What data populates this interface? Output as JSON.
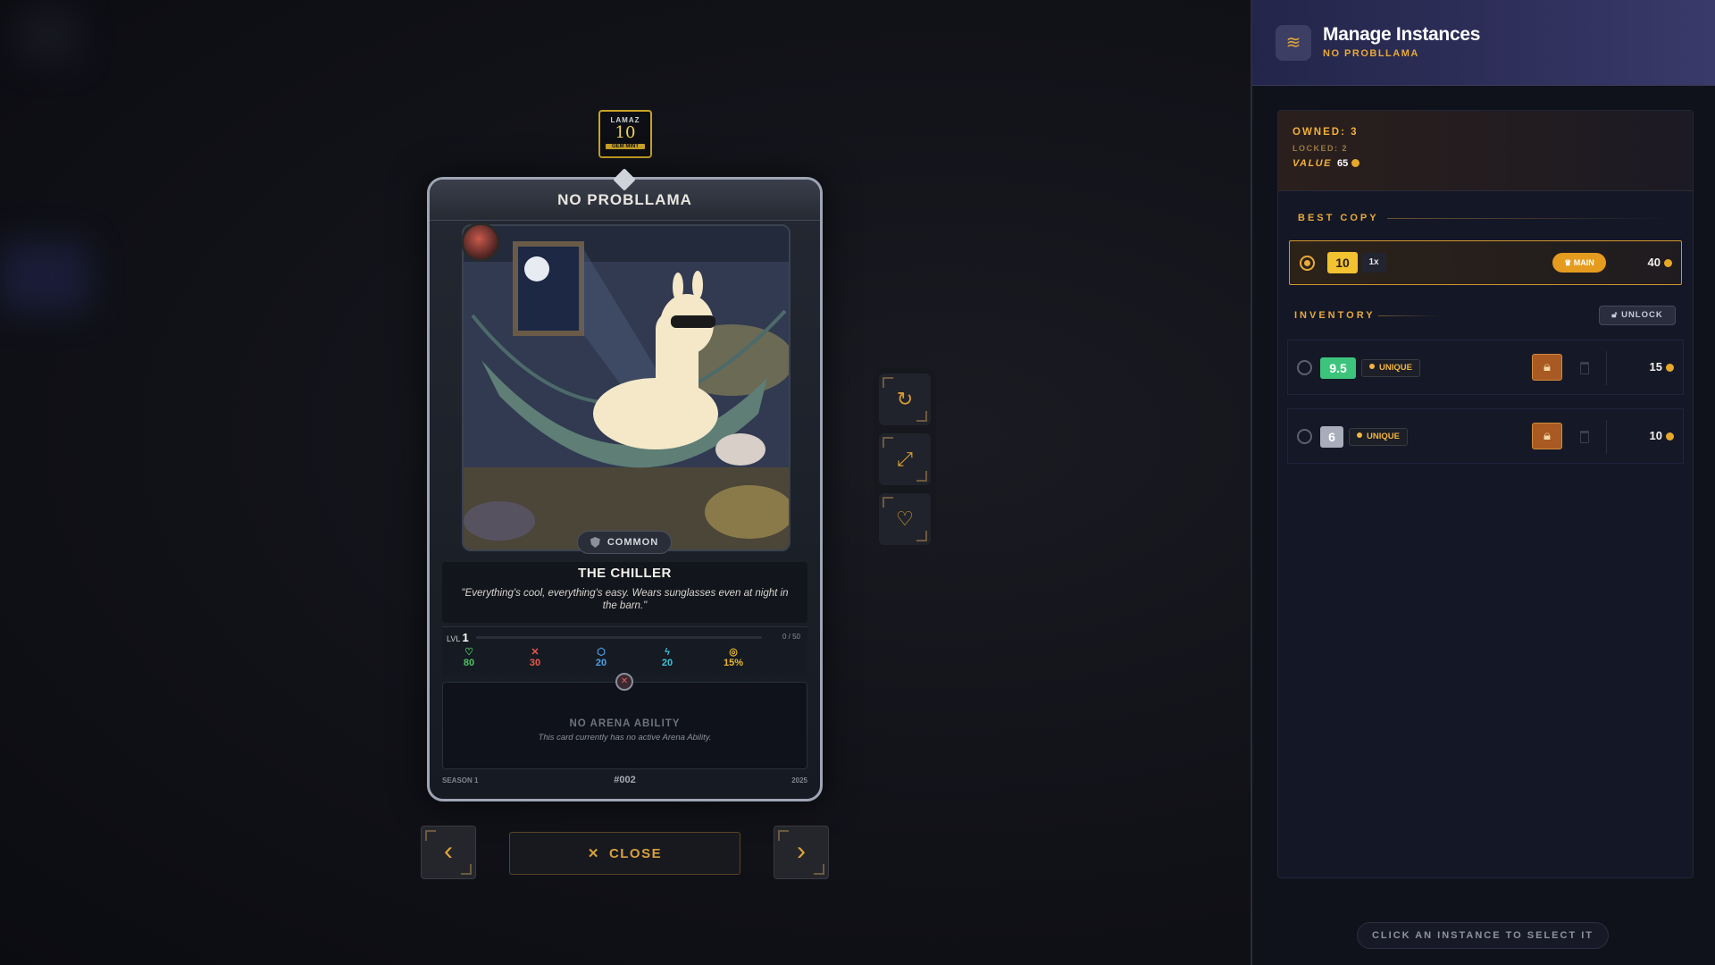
{
  "card": {
    "grade_brand": "LAMAZ",
    "grade_value": "10",
    "grade_label": "GEM MINT",
    "title": "NO PROBLLAMA",
    "rarity": "COMMON",
    "character_name": "THE CHILLER",
    "quote": "\"Everything's cool, everything's easy. Wears sunglasses even at night in the barn.\"",
    "level_label": "LVL",
    "level": "1",
    "xp": "0 / 50",
    "stats": [
      {
        "icon": "heart-icon",
        "glyph": "♡",
        "value": "80",
        "color": "#4cc564"
      },
      {
        "icon": "swords-icon",
        "glyph": "✕",
        "value": "30",
        "color": "#e8584c"
      },
      {
        "icon": "shield-icon",
        "glyph": "⬡",
        "value": "20",
        "color": "#4aa3e8"
      },
      {
        "icon": "bolt-icon",
        "glyph": "ϟ",
        "value": "20",
        "color": "#3ac4d8"
      },
      {
        "icon": "crit-icon",
        "glyph": "◎",
        "value": "15%",
        "color": "#e8b830"
      }
    ],
    "ability_title": "NO ARENA ABILITY",
    "ability_desc": "This card currently has no active Arena Ability.",
    "season": "SEASON 1",
    "number": "#002",
    "year": "2025"
  },
  "side_controls": [
    "rotate-icon",
    "expand-icon",
    "heart-icon"
  ],
  "nav": {
    "prev_glyph": "‹",
    "next_glyph": "›",
    "close_label": "CLOSE",
    "close_glyph": "✕"
  },
  "panel": {
    "title": "Manage Instances",
    "subtitle": "NO PROBLLAMA",
    "owned": "OWNED: 3",
    "locked_label": "LOCKED:",
    "locked_value": "2",
    "value_label": "VALUE",
    "value_amount": "65",
    "best_copy_label": "BEST COPY",
    "best": {
      "grade": "10",
      "mult": "1x",
      "badge": "MAIN",
      "value": "40"
    },
    "inventory_label": "INVENTORY",
    "unlock_label": "UNLOCK",
    "inventory": [
      {
        "grade": "9.5",
        "tag": "UNIQUE",
        "value": "15",
        "grade_color": "#3cc47c"
      },
      {
        "grade": "6",
        "tag": "UNIQUE",
        "value": "10",
        "grade_color": "#a7adbb"
      }
    ],
    "hint": "CLICK AN INSTANCE TO SELECT IT"
  },
  "colors": {
    "accent": "#e8a93a",
    "panel_bg": "#10121b",
    "best_grade_bg": "#f2c230"
  }
}
